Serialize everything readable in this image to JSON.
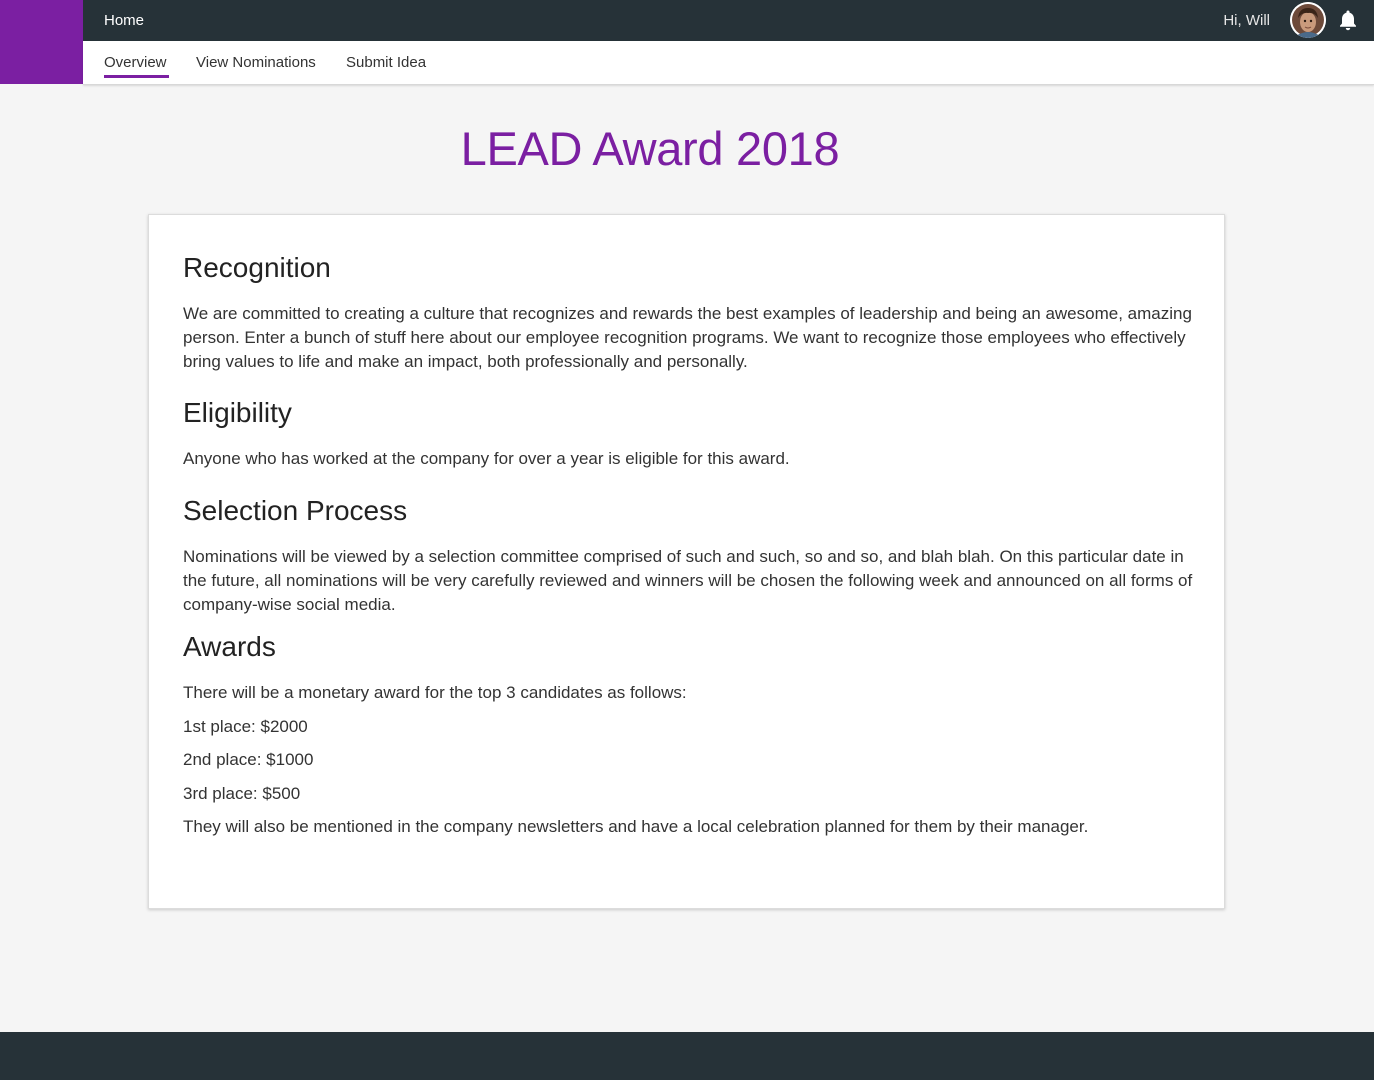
{
  "topbar": {
    "home_label": "Home",
    "greeting": "Hi, Will",
    "avatar_icon": "user-avatar",
    "notification_icon": "bell-icon"
  },
  "subnav": {
    "tabs": [
      {
        "label": "Overview",
        "active": true
      },
      {
        "label": "View Nominations",
        "active": false
      },
      {
        "label": "Submit Idea",
        "active": false
      }
    ]
  },
  "page": {
    "title": "LEAD Award 2018"
  },
  "sections": {
    "recognition": {
      "heading": "Recognition",
      "body": "We are committed to creating a culture that recognizes and rewards the best examples of leadership and being an awesome, amazing person. Enter a bunch of stuff here about our employee recognition programs. We want to recognize those employees who effectively bring values to life and make an impact, both professionally and personally."
    },
    "eligibility": {
      "heading": "Eligibility",
      "body": "Anyone who has worked at the company for over a year is eligible for this award."
    },
    "selection": {
      "heading": "Selection Process",
      "body": "Nominations will be viewed by a selection committee comprised of such and such, so and so, and blah blah. On this particular date in the future, all nominations will be very carefully reviewed and winners will be chosen the following week and announced on all forms of company-wise social media."
    },
    "awards": {
      "heading": "Awards",
      "intro": "There will be a monetary award for the top 3 candidates as follows:",
      "places": [
        "1st place: $2000",
        "2nd place: $1000",
        "3rd place: $500"
      ],
      "outro": "They will also be mentioned in the company newsletters and have a local celebration planned for them by their manager."
    }
  },
  "colors": {
    "brand": "#7b1fa2",
    "topbar": "#263238",
    "background": "#f5f5f5"
  }
}
